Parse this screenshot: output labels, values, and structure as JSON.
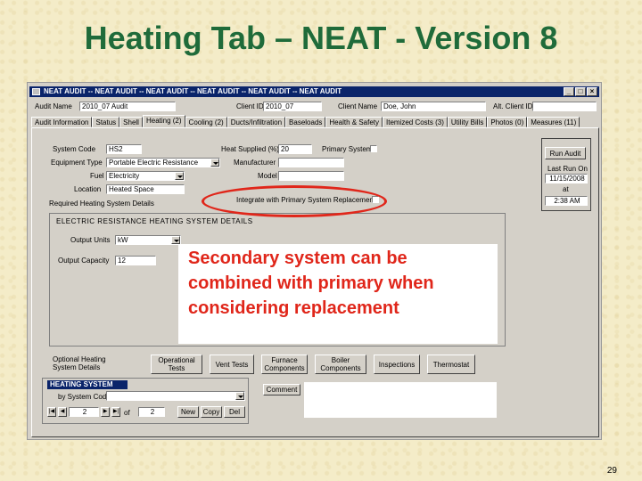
{
  "slide": {
    "title": "Heating Tab – NEAT - Version 8",
    "page_number": "29",
    "callout_lines": [
      "Secondary system can be",
      "combined with primary when",
      "considering replacement"
    ]
  },
  "window": {
    "title": "NEAT AUDIT  -- NEAT AUDIT  -- NEAT AUDIT  -- NEAT AUDIT  -- NEAT AUDIT  -- NEAT AUDIT",
    "min": "_",
    "max": "□",
    "close": "×"
  },
  "header": {
    "audit_name_label": "Audit Name",
    "audit_name_value": "2010_07 Audit",
    "client_id_label": "Client ID",
    "client_id_value": "2010_07",
    "client_name_label": "Client Name",
    "client_name_value": "Doe, John",
    "alt_client_id_label": "Alt. Client ID",
    "alt_client_id_value": ""
  },
  "tabs": [
    "Audit Information",
    "Status",
    "Shell",
    "Heating (2)",
    "Cooling (2)",
    "Ducts/Infiltration",
    "Baseloads",
    "Health & Safety",
    "Itemized Costs (3)",
    "Utility Bills",
    "Photos (0)",
    "Measures (11)"
  ],
  "form": {
    "system_code_label": "System Code",
    "system_code_value": "HS2",
    "equipment_type_label": "Equipment Type",
    "equipment_type_value": "Portable Electric Resistance",
    "fuel_label": "Fuel",
    "fuel_value": "Electricity",
    "location_label": "Location",
    "location_value": "Heated Space",
    "heat_supplied_label": "Heat Supplied (%)",
    "heat_supplied_value": "20",
    "primary_system_label": "Primary System",
    "manufacturer_label": "Manufacturer",
    "model_label": "Model",
    "integrate_label": "Integrate with Primary System Replacement",
    "required_details_label": "Required Heating System Details",
    "group_title": "ELECTRIC RESISTANCE HEATING SYSTEM DETAILS",
    "output_units_label": "Output Units",
    "output_units_value": "kW",
    "output_capacity_label": "Output Capacity",
    "output_capacity_value": "12"
  },
  "run_audit": {
    "button": "Run Audit",
    "last_run_label": "Last Run On",
    "date": "11/15/2008",
    "at": "at",
    "time": "2:38 AM"
  },
  "bottom": {
    "optional_label": "Optional Heating System Details",
    "buttons": [
      "Operational Tests",
      "Vent Tests",
      "Furnace Components",
      "Boiler Components",
      "Inspections",
      "Thermostat"
    ],
    "heating_system_header": "HEATING SYSTEM",
    "by_system_code": "by System Code",
    "record_current": "2",
    "record_of": "of",
    "record_total": "2",
    "new": "New",
    "copy": "Copy",
    "del": "Del",
    "comment": "Comment"
  },
  "colors": {
    "title_green": "#1f6b3a",
    "callout_red": "#e0261a",
    "titlebar_blue": "#0a246a"
  }
}
